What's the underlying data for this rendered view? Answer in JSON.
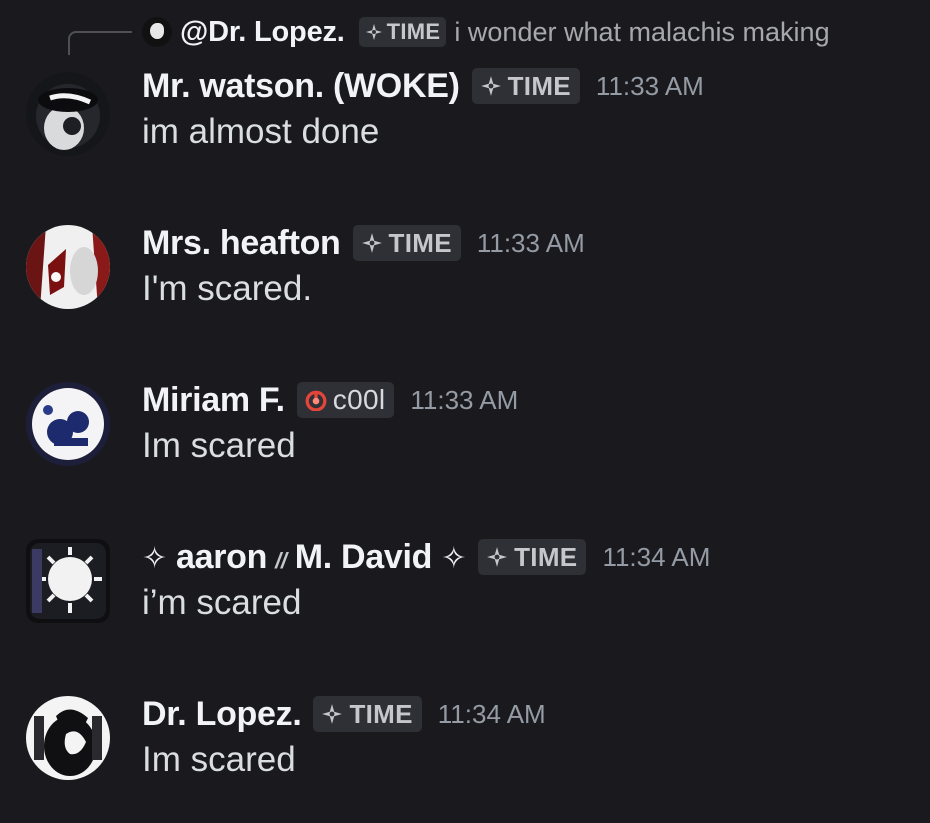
{
  "reply": {
    "name": "@Dr. Lopez.",
    "tag": "TIME",
    "text": "i wonder what malachis making"
  },
  "messages": [
    {
      "name": "Mr. watson. (WOKE)",
      "tag": "TIME",
      "time": "11:33 AM",
      "text": "im almost done",
      "avatar": "watson-avatar"
    },
    {
      "name": "Mrs. heafton",
      "tag": "TIME",
      "time": "11:33 AM",
      "text": "I'm scared.",
      "avatar": "heafton-avatar"
    },
    {
      "name": "Miriam F.",
      "tag": "c00l",
      "time": "11:33 AM",
      "text": "Im scared",
      "avatar": "miriam-avatar"
    },
    {
      "name_left": "aaron",
      "name_sep": "//",
      "name_right": "M. David",
      "tag": "TIME",
      "time": "11:34 AM",
      "text": "i’m scared",
      "avatar": "aaron-avatar"
    },
    {
      "name": "Dr. Lopez.",
      "tag": "TIME",
      "time": "11:34 AM",
      "text": "Im scared",
      "avatar": "lopez-avatar"
    }
  ],
  "colors": {
    "background": "#1a1a1e",
    "tag_bg": "#2e3036",
    "timestamp": "#949ba4",
    "cool_icon": "#e2453a"
  }
}
